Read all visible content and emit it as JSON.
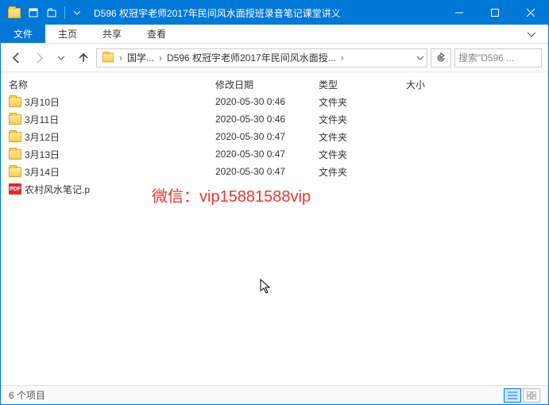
{
  "window": {
    "title": "D596 权冠宇老师2017年民间风水面授班录音笔记课堂讲义"
  },
  "ribbon": {
    "file": "文件",
    "tabs": [
      "主页",
      "共享",
      "查看"
    ]
  },
  "breadcrumb": {
    "segments": [
      "国学...",
      "D596 权冠宇老师2017年民间风水面授..."
    ]
  },
  "search": {
    "placeholder": "搜索\"D596 ..."
  },
  "columns": {
    "name": "名称",
    "date": "修改日期",
    "type": "类型",
    "size": "大小"
  },
  "items": [
    {
      "icon": "folder",
      "name": "3月10日",
      "date": "2020-05-30 0:46",
      "type": "文件夹",
      "size": ""
    },
    {
      "icon": "folder",
      "name": "3月11日",
      "date": "2020-05-30 0:46",
      "type": "文件夹",
      "size": ""
    },
    {
      "icon": "folder",
      "name": "3月12日",
      "date": "2020-05-30 0:47",
      "type": "文件夹",
      "size": ""
    },
    {
      "icon": "folder",
      "name": "3月13日",
      "date": "2020-05-30 0:47",
      "type": "文件夹",
      "size": ""
    },
    {
      "icon": "folder",
      "name": "3月14日",
      "date": "2020-05-30 0:47",
      "type": "文件夹",
      "size": ""
    },
    {
      "icon": "pdf",
      "name": "农村风水笔记.p",
      "date": "",
      "type": "",
      "size": ""
    }
  ],
  "watermark": "微信：vip15881588vip",
  "status": {
    "count": "6 个项目"
  }
}
